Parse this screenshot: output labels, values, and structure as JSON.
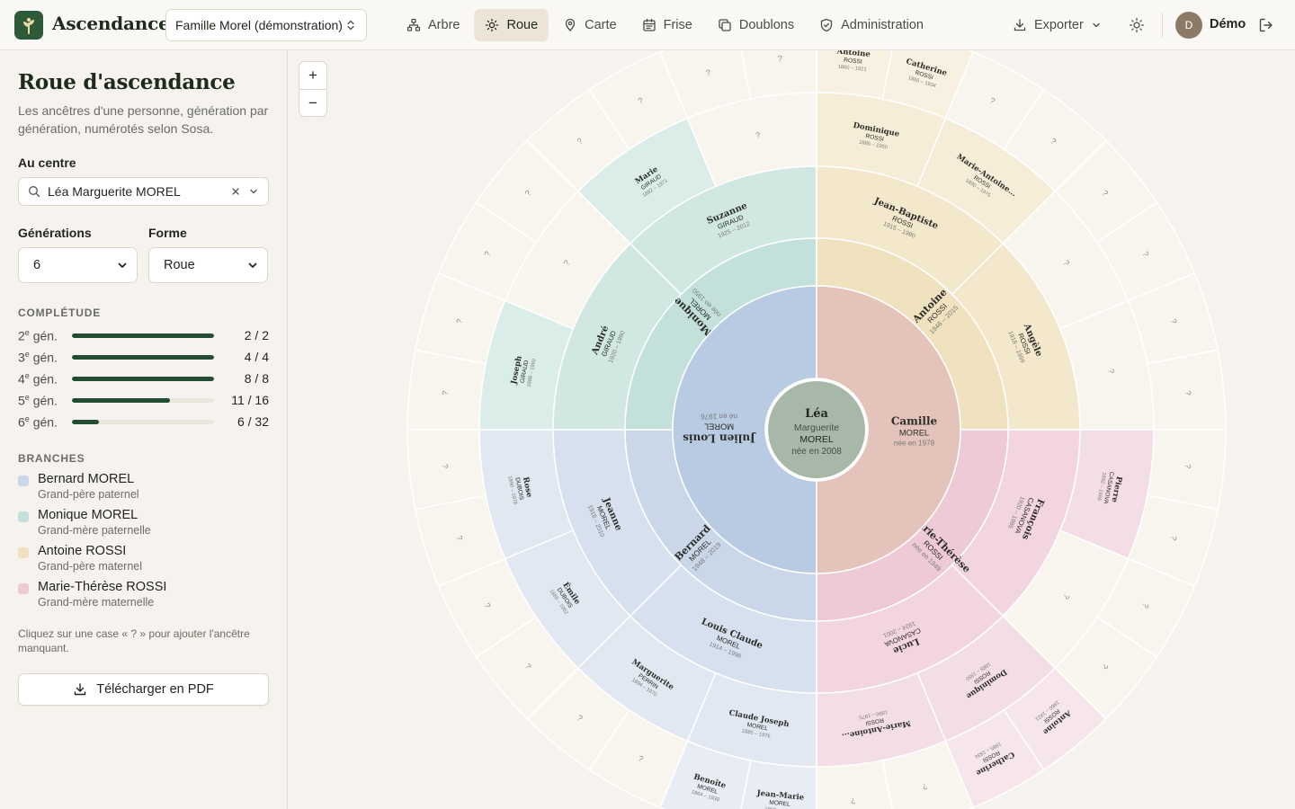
{
  "app": {
    "name": "Ascendance",
    "tree": "Famille Morel (démonstration)"
  },
  "nav": [
    {
      "id": "arbre",
      "label": "Arbre",
      "icon": "tree-icon"
    },
    {
      "id": "roue",
      "label": "Roue",
      "icon": "sun-icon",
      "active": true
    },
    {
      "id": "carte",
      "label": "Carte",
      "icon": "map-pin-icon"
    },
    {
      "id": "frise",
      "label": "Frise",
      "icon": "calendar-icon"
    },
    {
      "id": "doublons",
      "label": "Doublons",
      "icon": "copy-icon"
    },
    {
      "id": "administration",
      "label": "Administration",
      "icon": "shield-icon"
    }
  ],
  "header": {
    "export_label": "Exporter",
    "user_initial": "D",
    "user_name": "Démo"
  },
  "sidebar": {
    "title": "Roue d'ascendance",
    "description": "Les ancêtres d'une personne, génération par génération, numérotés selon Sosa.",
    "center_label": "Au centre",
    "center_value": "Léa Marguerite MOREL",
    "generations_label": "Générations",
    "generations_value": "6",
    "shape_label": "Forme",
    "shape_value": "Roue",
    "completeness_label": "COMPLÉTUDE",
    "completeness": [
      {
        "gen": "2",
        "found": 2,
        "total": 2,
        "text": "2 / 2"
      },
      {
        "gen": "3",
        "found": 4,
        "total": 4,
        "text": "4 / 4"
      },
      {
        "gen": "4",
        "found": 8,
        "total": 8,
        "text": "8 / 8"
      },
      {
        "gen": "5",
        "found": 11,
        "total": 16,
        "text": "11 / 16"
      },
      {
        "gen": "6",
        "found": 6,
        "total": 32,
        "text": "6 / 32"
      }
    ],
    "gen_suffix": "e",
    "gen_word": "gén.",
    "branches_label": "BRANCHES",
    "branches": [
      {
        "name": "Bernard MOREL",
        "role": "Grand-père paternel",
        "color": "#c9d7e8"
      },
      {
        "name": "Monique MOREL",
        "role": "Grand-mère paternelle",
        "color": "#c3e0da"
      },
      {
        "name": "Antoine ROSSI",
        "role": "Grand-père maternel",
        "color": "#f0e2bf"
      },
      {
        "name": "Marie-Thérèse ROSSI",
        "role": "Grand-mère maternelle",
        "color": "#eec9d6"
      }
    ],
    "hint": "Cliquez sur une case « ? » pour ajouter l'ancêtre manquant.",
    "pdf_label": "Télécharger en PDF"
  },
  "zoom": {
    "in": "+",
    "out": "−"
  },
  "colors": {
    "center": "#a7b8a9",
    "bernard": [
      "#b9cbe3",
      "#c9d7e8",
      "#d6e0ee",
      "#e1e8f2",
      "#e8edf5"
    ],
    "monique": [
      "#b2d6d0",
      "#c3e0da",
      "#d0e7e2",
      "#dbede9",
      "#e4f1ee"
    ],
    "antoine": [
      "#e9d2b3",
      "#f0e2bf",
      "#f4e8cc",
      "#f6edd8",
      "#f8f1e2"
    ],
    "marie": [
      "#e3c3ba",
      "#eec9d6",
      "#f2d5df",
      "#f4dee6",
      "#f6e5eb"
    ],
    "empty": "#f8f5ef",
    "accent": "#234d33"
  },
  "center_person": {
    "first": "Léa",
    "middle": "Marguerite",
    "last": "MOREL",
    "dates": "née en 2008"
  },
  "empty_label": "?",
  "ancestors": [
    {
      "sosa": 2,
      "first": "Julien Louis",
      "last": "MOREL",
      "dates": "né en 1976"
    },
    {
      "sosa": 3,
      "first": "Camille",
      "last": "MOREL",
      "dates": "née en 1978"
    },
    {
      "sosa": 4,
      "first": "Bernard",
      "last": "MOREL",
      "dates": "1948 – 2019"
    },
    {
      "sosa": 5,
      "first": "Monique",
      "last": "MOREL",
      "dates": "née en 1950"
    },
    {
      "sosa": 6,
      "first": "Antoine",
      "last": "ROSSI",
      "dates": "1946 – 2015"
    },
    {
      "sosa": 7,
      "first": "Marie-Thérèse",
      "last": "ROSSI",
      "dates": "née en 1949"
    },
    {
      "sosa": 8,
      "first": "Louis Claude",
      "last": "MOREL",
      "dates": "1914 – 1998"
    },
    {
      "sosa": 9,
      "first": "Jeanne",
      "last": "MOREL",
      "dates": "1918 – 2010"
    },
    {
      "sosa": 10,
      "first": "André",
      "last": "GIRAUD",
      "dates": "1920 – 1990"
    },
    {
      "sosa": 11,
      "first": "Suzanne",
      "last": "GIRAUD",
      "dates": "1925 – 2012"
    },
    {
      "sosa": 12,
      "first": "Jean-Baptiste",
      "last": "ROSSI",
      "dates": "1915 – 1980"
    },
    {
      "sosa": 13,
      "first": "Angèle",
      "last": "ROSSI",
      "dates": "1918 – 1999"
    },
    {
      "sosa": 14,
      "first": "François",
      "last": "CASANOVA",
      "dates": "1920 – 1985"
    },
    {
      "sosa": 15,
      "first": "Lucie",
      "last": "CASANOVA",
      "dates": "1924 – 2001"
    },
    {
      "sosa": 16,
      "first": "Claude Joseph",
      "last": "MOREL",
      "dates": "1885 – 1976"
    },
    {
      "sosa": 17,
      "first": "Marguerite",
      "last": "PERRIN",
      "dates": "1894 – 1970"
    },
    {
      "sosa": 18,
      "first": "Émile",
      "last": "DUBOIS",
      "dates": "1885 – 1952"
    },
    {
      "sosa": 19,
      "first": "Rose",
      "last": "DUBOIS",
      "dates": "1890 – 1978"
    },
    {
      "sosa": 20,
      "first": "Joseph",
      "last": "GIRAUD",
      "dates": "1888 – 1960"
    },
    {
      "sosa": 22,
      "first": "Marie",
      "last": "GIRAUD",
      "dates": "1892 – 1971"
    },
    {
      "sosa": 24,
      "first": "Dominique",
      "last": "ROSSI",
      "dates": "1885 – 1950"
    },
    {
      "sosa": 25,
      "first": "Marie-Antoine...",
      "last": "ROSSI",
      "dates": "1890 – 1975"
    },
    {
      "sosa": 28,
      "first": "Pierre",
      "last": "CASANOVA",
      "dates": "1892 – 1966"
    },
    {
      "sosa": 30,
      "first": "Dominique",
      "last": "ROSSI",
      "dates": "1885 – 1950"
    },
    {
      "sosa": 31,
      "first": "Marie-Antoine...",
      "last": "ROSSI",
      "dates": "1890 – 1975"
    },
    {
      "sosa": 32,
      "first": "Jean-Marie",
      "last": "MOREL",
      "dates": "1860 – 1935"
    },
    {
      "sosa": 33,
      "first": "Benoîte",
      "last": "MOREL",
      "dates": "1864 – 1930"
    },
    {
      "sosa": 48,
      "first": "Antoine",
      "last": "ROSSI",
      "dates": "1860 – 1921"
    },
    {
      "sosa": 49,
      "first": "Catherine",
      "last": "ROSSI",
      "dates": "1865 – 1934"
    },
    {
      "sosa": 60,
      "first": "Antoine",
      "last": "ROSSI",
      "dates": "1860 – 1921"
    },
    {
      "sosa": 61,
      "first": "Catherine",
      "last": "ROSSI",
      "dates": "1865 – 1934"
    }
  ]
}
